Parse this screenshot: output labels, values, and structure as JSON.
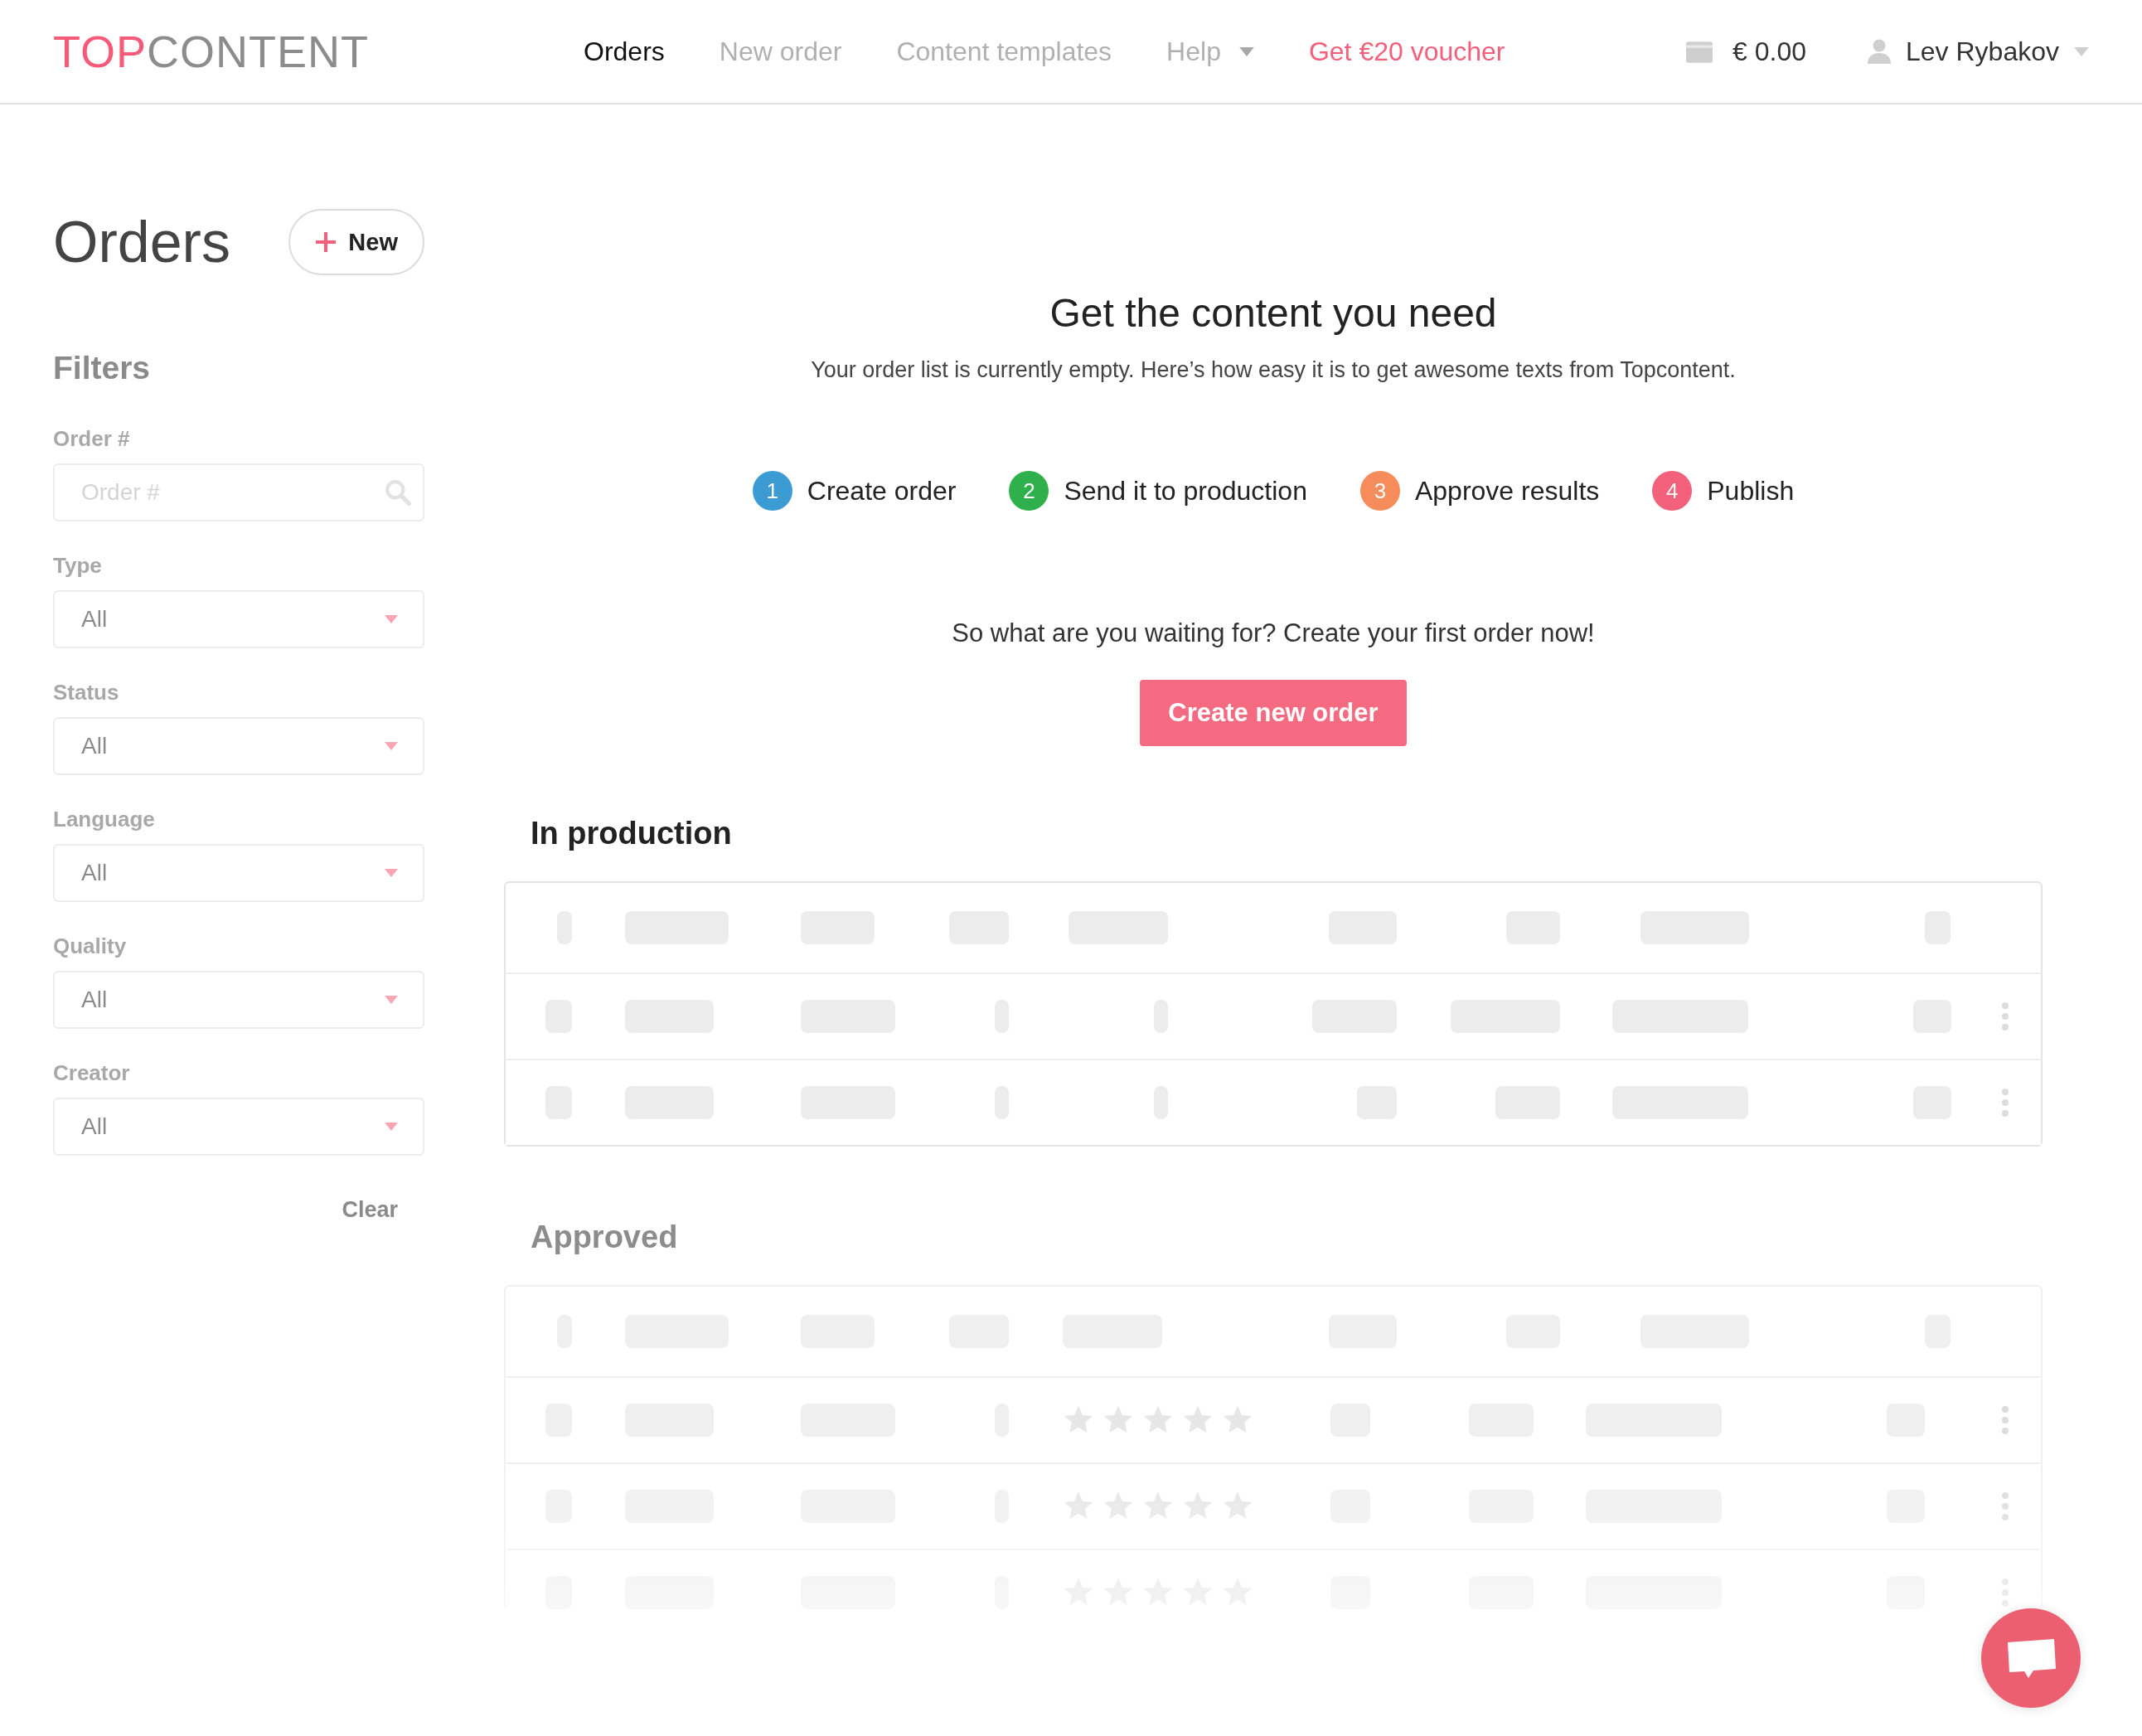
{
  "logo": {
    "first": "TOP",
    "second": "CONTENT"
  },
  "nav": [
    {
      "label": "Orders",
      "selected": true,
      "kind": "link",
      "dropdown": false
    },
    {
      "label": "New order",
      "selected": false,
      "kind": "link",
      "dropdown": false
    },
    {
      "label": "Content templates",
      "selected": false,
      "kind": "link",
      "dropdown": false
    },
    {
      "label": "Help",
      "selected": false,
      "kind": "link",
      "dropdown": true
    },
    {
      "label": "Get €20 voucher",
      "selected": false,
      "kind": "promo",
      "dropdown": false
    }
  ],
  "balance": "€ 0.00",
  "user": "Lev Rybakov",
  "sidebar": {
    "title": "Orders",
    "new_button": "New",
    "filters_title": "Filters",
    "filters": [
      {
        "label": "Order #",
        "kind": "search",
        "placeholder": "Order #"
      },
      {
        "label": "Type",
        "kind": "select",
        "value": "All"
      },
      {
        "label": "Status",
        "kind": "select",
        "value": "All"
      },
      {
        "label": "Language",
        "kind": "select",
        "value": "All"
      },
      {
        "label": "Quality",
        "kind": "select",
        "value": "All"
      },
      {
        "label": "Creator",
        "kind": "select",
        "value": "All"
      }
    ],
    "clear": "Clear"
  },
  "intro": {
    "title": "Get the content you need",
    "text": "Your order list is currently empty. Here’s how easy it is to get awesome texts from Topcontent.",
    "steps": [
      {
        "number": "1",
        "label": "Create order",
        "color": "#3d9bd3"
      },
      {
        "number": "2",
        "label": "Send it to production",
        "color": "#2fb04c"
      },
      {
        "number": "3",
        "label": "Approve results",
        "color": "#f68b5c"
      },
      {
        "number": "4",
        "label": "Publish",
        "color": "#f2607b"
      }
    ],
    "prompt": "So what are you waiting for? Create your first order now!",
    "button": "Create new order"
  },
  "sections": [
    {
      "title": "In production",
      "muted": false,
      "kind": "plain"
    },
    {
      "title": "Approved",
      "muted": true,
      "kind": "rated"
    }
  ]
}
